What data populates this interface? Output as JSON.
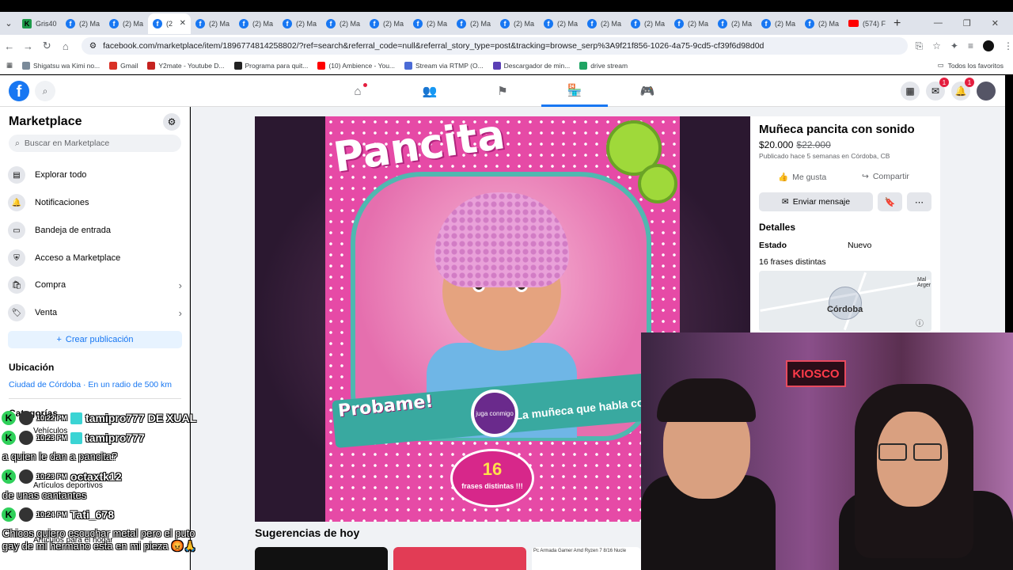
{
  "browser": {
    "tabs": [
      {
        "label": "Gris40",
        "icon": "green-k-icon"
      },
      {
        "label": "(2) Ma",
        "icon": "facebook-icon"
      },
      {
        "label": "(2) Ma",
        "icon": "facebook-icon"
      },
      {
        "label": "(2",
        "icon": "facebook-icon"
      },
      {
        "label": "(2) Ma",
        "icon": "facebook-icon"
      },
      {
        "label": "(2) Ma",
        "icon": "facebook-icon"
      },
      {
        "label": "(2) Ma",
        "icon": "facebook-icon"
      },
      {
        "label": "(2) Ma",
        "icon": "facebook-icon"
      },
      {
        "label": "(2) Ma",
        "icon": "facebook-icon"
      },
      {
        "label": "(2) Ma",
        "icon": "facebook-icon"
      },
      {
        "label": "(2) Ma",
        "icon": "facebook-icon"
      },
      {
        "label": "(2) Ma",
        "icon": "facebook-icon"
      },
      {
        "label": "(2) Ma",
        "icon": "facebook-icon"
      },
      {
        "label": "(2) Ma",
        "icon": "facebook-icon"
      },
      {
        "label": "(2) Ma",
        "icon": "facebook-icon"
      },
      {
        "label": "(2) Ma",
        "icon": "facebook-icon"
      },
      {
        "label": "(2) Ma",
        "icon": "facebook-icon"
      },
      {
        "label": "(2) Ma",
        "icon": "facebook-icon"
      },
      {
        "label": "(2) Ma",
        "icon": "facebook-icon"
      },
      {
        "label": "(574) F",
        "icon": "youtube-icon"
      }
    ],
    "url": "facebook.com/marketplace/item/1896774814258802/?ref=search&referral_code=null&referral_story_type=post&tracking=browse_serp%3A9f21f856-1026-4a75-9cd5-cf39f6d98d0d",
    "bookmarks": [
      "Shigatsu wa Kimi no...",
      "Gmail",
      "Y2mate - Youtube D...",
      "Programa para quit...",
      "(10) Ambience - You...",
      "Stream via RTMP (O...",
      "Descargador de min...",
      "drive stream"
    ],
    "bookmarks_right": "Todos los favoritos"
  },
  "fb": {
    "logo": "f",
    "badges": {
      "messenger": "1",
      "notifications": "1"
    }
  },
  "sidebar": {
    "title": "Marketplace",
    "search_placeholder": "Buscar en Marketplace",
    "items": [
      {
        "label": "Explorar todo",
        "icon": "store-icon"
      },
      {
        "label": "Notificaciones",
        "icon": "bell-icon"
      },
      {
        "label": "Bandeja de entrada",
        "icon": "inbox-icon"
      },
      {
        "label": "Acceso a Marketplace",
        "icon": "shield-icon"
      },
      {
        "label": "Compra",
        "icon": "shopping-bag-icon"
      },
      {
        "label": "Venta",
        "icon": "tag-icon"
      }
    ],
    "create_label": "Crear publicación",
    "location_title": "Ubicación",
    "location_value": "Ciudad de Córdoba · En un radio de 500 km",
    "categories_title": "Categorías",
    "categories": [
      "Vehículos",
      "Artículos deportivos",
      "Artículos para el hogar"
    ]
  },
  "listing": {
    "title": "Muñeca pancita con sonido",
    "price": "$20.000",
    "old_price": "$22.000",
    "posted": "Publicado hace 5 semanas en Córdoba, CB",
    "like_label": "Me gusta",
    "share_label": "Compartir",
    "message_label": "Enviar mensaje",
    "details_title": "Detalles",
    "condition_label": "Estado",
    "condition_value": "Nuevo",
    "description": "16 frases distintas",
    "map_label": "Córdoba",
    "map_side": "Mal Arger"
  },
  "photo": {
    "brand": "Pancita",
    "probame": "Probame!",
    "banner_text": "La muñeca que habla con vo",
    "badge_text": "juga conmigo",
    "frases_num": "16",
    "frases_label": "frases distintas !!!"
  },
  "suggestions_title": "Sugerencias de hoy",
  "suggestion_snippet": "Pc Armada Gamer Amd Ryzen 7 8/16 Nucle",
  "webcam": {
    "sign": "KIOSCO"
  },
  "chat": [
    {
      "time": "10:22 PM",
      "user": "tamipro777",
      "extra": "DE XUAL",
      "msg": ""
    },
    {
      "time": "10:23 PM",
      "user": "tamipro777",
      "extra": "",
      "msg": "a quien le dan a pancita?"
    },
    {
      "time": "10:23 PM",
      "user": "octaxtk12",
      "extra": "",
      "msg": "de unas cantantes"
    },
    {
      "time": "10:24 PM",
      "user": "Tati_678",
      "extra": "",
      "msg": "Chicos quiero escuchar metal pero el puto gay de mi hermano esta en mi pieza 😡🙏"
    }
  ],
  "colors": {
    "fb_blue": "#1877f2",
    "fb_bg": "#f0f2f5",
    "chat_green": "#2fd05a"
  }
}
